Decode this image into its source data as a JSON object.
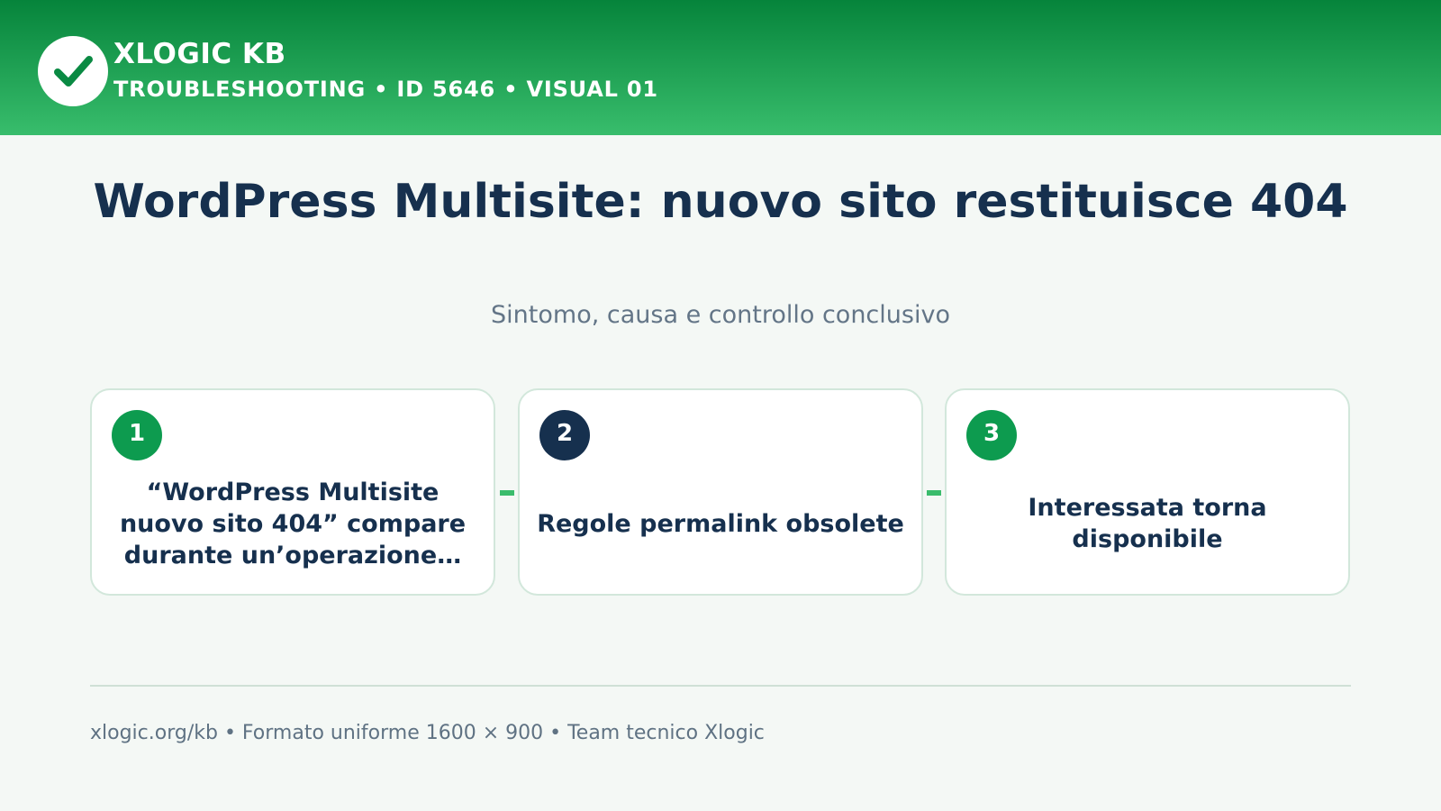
{
  "header": {
    "brand": "XLOGIC KB",
    "meta": "TROUBLESHOOTING • ID 5646 • VISUAL 01",
    "logo_icon": "check-circle-icon"
  },
  "main": {
    "title": "WordPress Multisite: nuovo sito restituisce 404",
    "subtitle": "Sintomo, causa e controllo conclusivo"
  },
  "steps": [
    {
      "number": "1",
      "text": "“WordPress Multisite nuovo sito 404” compare durante un’operazione…",
      "color": "#0d9b4f"
    },
    {
      "number": "2",
      "text": "Regole permalink obsolete",
      "color": "#16304e"
    },
    {
      "number": "3",
      "text": "Interessata torna disponibile",
      "color": "#0d9b4f"
    }
  ],
  "footer": {
    "text": "xlogic.org/kb • Formato uniforme 1600 × 900 • Team tecnico Xlogic"
  },
  "colors": {
    "header_top": "#06843b",
    "header_bottom": "#38bd6c",
    "title": "#16304e",
    "accent_green": "#0d9b4f",
    "accent_navy": "#16304e",
    "connector": "#3abc6c"
  }
}
